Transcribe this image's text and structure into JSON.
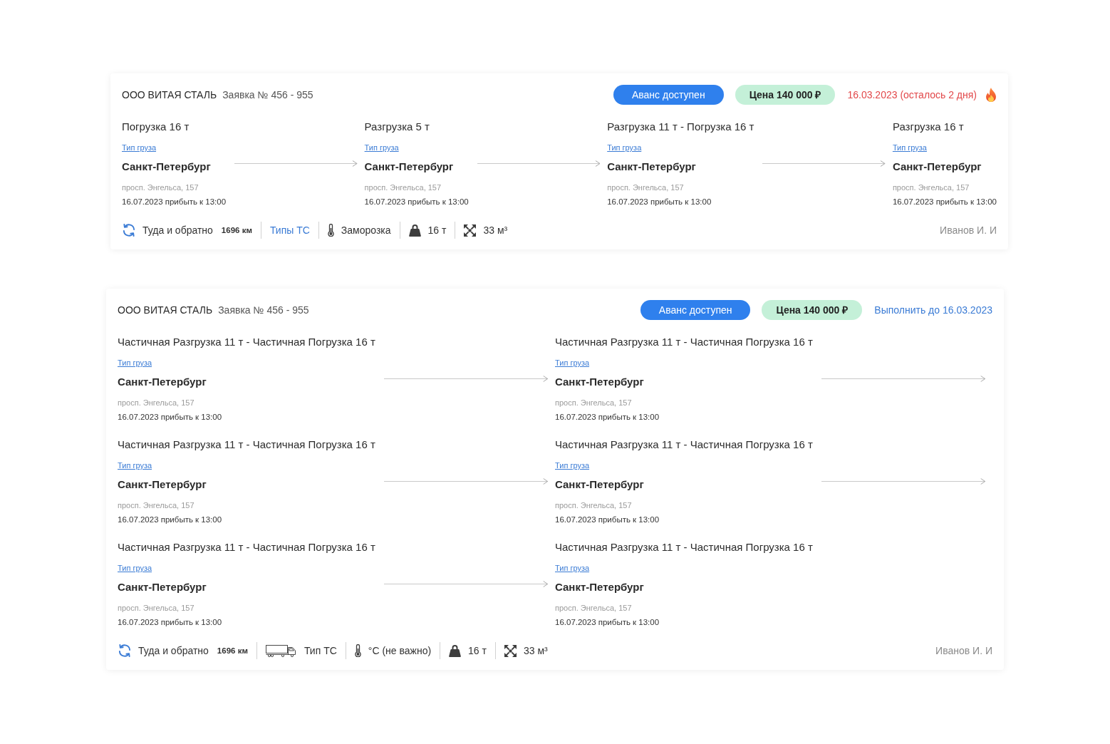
{
  "orders": [
    {
      "company": "ООО ВИТАЯ СТАЛЬ",
      "order_number": "Заявка № 456 - 955",
      "advance_button": "Аванс доступен",
      "price_badge": "Цена 140 000 ₽",
      "deadline": {
        "kind": "urgent",
        "text": "16.03.2023 (осталось 2 дня)"
      },
      "stop_rows": [
        [
          {
            "title": "Погрузка 16 т",
            "cargo_link": "Тип груза",
            "city": "Санкт-Петербург",
            "address": "просп. Энгельса, 157",
            "arrival": "16.07.2023 прибыть к 13:00"
          },
          {
            "title": "Разгрузка 5 т",
            "cargo_link": "Тип груза",
            "city": "Санкт-Петербург",
            "address": "просп. Энгельса, 157",
            "arrival": "16.07.2023 прибыть к 13:00"
          },
          {
            "title": "Разгрузка 11 т - Погрузка 16 т",
            "cargo_link": "Тип груза",
            "city": "Санкт-Петербург",
            "address": "просп. Энгельса, 157",
            "arrival": "16.07.2023 прибыть к 13:00"
          },
          {
            "title": "Разгрузка 16 т",
            "cargo_link": "Тип груза",
            "city": "Санкт-Петербург",
            "address": "просп. Энгельса, 157",
            "arrival": "16.07.2023 прибыть к 13:00"
          }
        ]
      ],
      "specs": [
        {
          "kind": "route",
          "text": "Туда и обратно",
          "distance": "1696 км"
        },
        {
          "kind": "link",
          "text": "Типы ТС"
        },
        {
          "kind": "temperature",
          "text": "Заморозка"
        },
        {
          "kind": "weight",
          "text": "16 т"
        },
        {
          "kind": "volume",
          "text": "33 м³"
        }
      ],
      "manager": "Иванов И. И"
    },
    {
      "company": "ООО ВИТАЯ СТАЛЬ",
      "order_number": "Заявка № 456 - 955",
      "advance_button": "Аванс доступен",
      "price_badge": "Цена 140 000 ₽",
      "deadline": {
        "kind": "due",
        "text": "Выполнить до 16.03.2023"
      },
      "stop_rows": [
        [
          {
            "title": "Частичная Разгрузка 11 т - Частичная Погрузка 16 т",
            "cargo_link": "Тип груза",
            "city": "Санкт-Петербург",
            "address": "просп. Энгельса, 157",
            "arrival": "16.07.2023 прибыть к 13:00"
          },
          {
            "title": "Частичная Разгрузка 11 т - Частичная Погрузка 16 т",
            "cargo_link": "Тип груза",
            "city": "Санкт-Петербург",
            "address": "просп. Энгельса, 157",
            "arrival": "16.07.2023 прибыть к 13:00"
          }
        ],
        [
          {
            "title": "Частичная Разгрузка 11 т - Частичная Погрузка 16 т",
            "cargo_link": "Тип груза",
            "city": "Санкт-Петербург",
            "address": "просп. Энгельса, 157",
            "arrival": "16.07.2023 прибыть к 13:00"
          },
          {
            "title": "Частичная Разгрузка 11 т - Частичная Погрузка 16 т",
            "cargo_link": "Тип груза",
            "city": "Санкт-Петербург",
            "address": "просп. Энгельса, 157",
            "arrival": "16.07.2023 прибыть к 13:00"
          }
        ],
        [
          {
            "title": "Частичная Разгрузка 11 т - Частичная Погрузка 16 т",
            "cargo_link": "Тип груза",
            "city": "Санкт-Петербург",
            "address": "просп. Энгельса, 157",
            "arrival": "16.07.2023 прибыть к 13:00"
          },
          {
            "title": "Частичная Разгрузка 11 т - Частичная Погрузка 16 т",
            "cargo_link": "Тип груза",
            "city": "Санкт-Петербург",
            "address": "просп. Энгельса, 157",
            "arrival": "16.07.2023 прибыть к 13:00"
          }
        ]
      ],
      "specs": [
        {
          "kind": "route",
          "text": "Туда и обратно",
          "distance": "1696 км"
        },
        {
          "kind": "vehicle",
          "text": "Тип ТС"
        },
        {
          "kind": "temperature",
          "text": "°C (не важно)"
        },
        {
          "kind": "weight",
          "text": "16 т"
        },
        {
          "kind": "volume",
          "text": "33 м³"
        }
      ],
      "manager": "Иванов И. И"
    }
  ]
}
